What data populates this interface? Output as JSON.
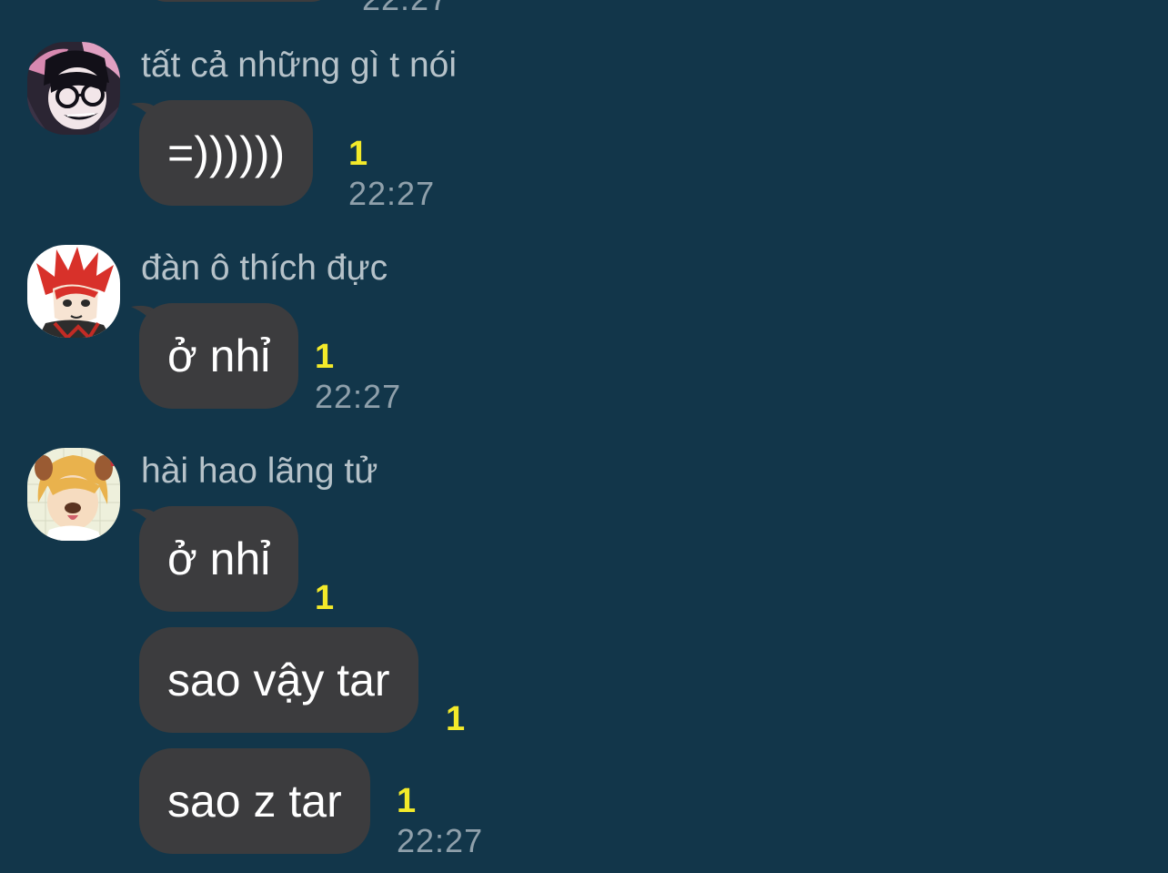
{
  "top_partial": {
    "time": "22:27"
  },
  "groups": [
    {
      "sender": "tất cả những gì t nói",
      "avatar_icon": "anime-glasses-avatar",
      "messages": [
        {
          "text": "=))))))",
          "unread": "1",
          "time": "22:27"
        }
      ]
    },
    {
      "sender": "đàn ô thích đực",
      "avatar_icon": "anime-red-hair-avatar",
      "messages": [
        {
          "text": "ở nhỉ",
          "unread": "1",
          "time": "22:27"
        }
      ]
    },
    {
      "sender": "hài hao lãng tử",
      "avatar_icon": "anime-blonde-dog-filter-avatar",
      "messages": [
        {
          "text": "ở nhỉ",
          "unread": "1",
          "time": ""
        },
        {
          "text": "sao vậy tar",
          "unread": "1",
          "time": ""
        },
        {
          "text": "sao z tar",
          "unread": "1",
          "time": "22:27"
        }
      ]
    }
  ],
  "colors": {
    "background": "#12364a",
    "bubble": "#3c3c3e",
    "unread": "#f3ea2a",
    "time": "#8fa0ab",
    "sender": "#b6c2c9"
  }
}
